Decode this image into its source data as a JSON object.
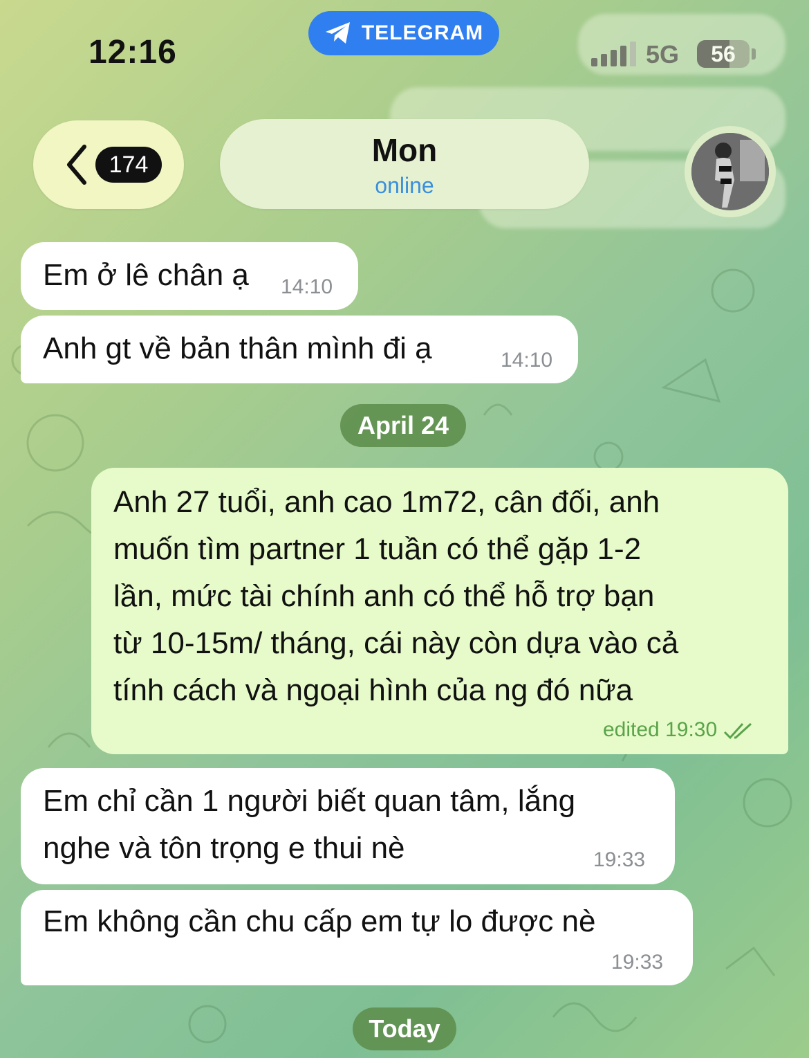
{
  "status_bar": {
    "time": "12:16",
    "app_pill_label": "TELEGRAM",
    "network": "5G",
    "battery": "56"
  },
  "header": {
    "back_count": "174",
    "chat_name": "Mon",
    "chat_status": "online"
  },
  "messages": [
    {
      "id": "m1",
      "direction": "in",
      "text": "Em ở lê chân ạ",
      "time": "14:10"
    },
    {
      "id": "m2",
      "direction": "in",
      "text": "Anh gt về bản thân mình đi ạ",
      "time": "14:10"
    },
    {
      "id": "m3",
      "direction": "out",
      "text": "Anh 27 tuổi, anh cao 1m72, cân đối, anh\nmuốn tìm partner 1 tuần có thể gặp 1-2\nlần, mức tài chính anh có thể hỗ trợ bạn\ntừ 10-15m/ tháng, cái này còn dựa vào cả\ntính cách và ngoại hình của ng đó nữa",
      "time": "edited 19:30"
    },
    {
      "id": "m4",
      "direction": "in",
      "text": "Em chỉ cần 1 người biết quan tâm, lắng\nnghe và tôn trọng e thui nè",
      "time": "19:33"
    },
    {
      "id": "m5",
      "direction": "in",
      "text": "Em không cần chu cấp em tự lo được nè",
      "time": "19:33"
    }
  ],
  "date_separators": {
    "first": "April 24",
    "second": "Today"
  },
  "colors": {
    "incoming_bubble": "#ffffff",
    "outgoing_bubble": "#e6fbc9",
    "outgoing_time": "#5aa34a",
    "accent": "#2f7ff0"
  }
}
